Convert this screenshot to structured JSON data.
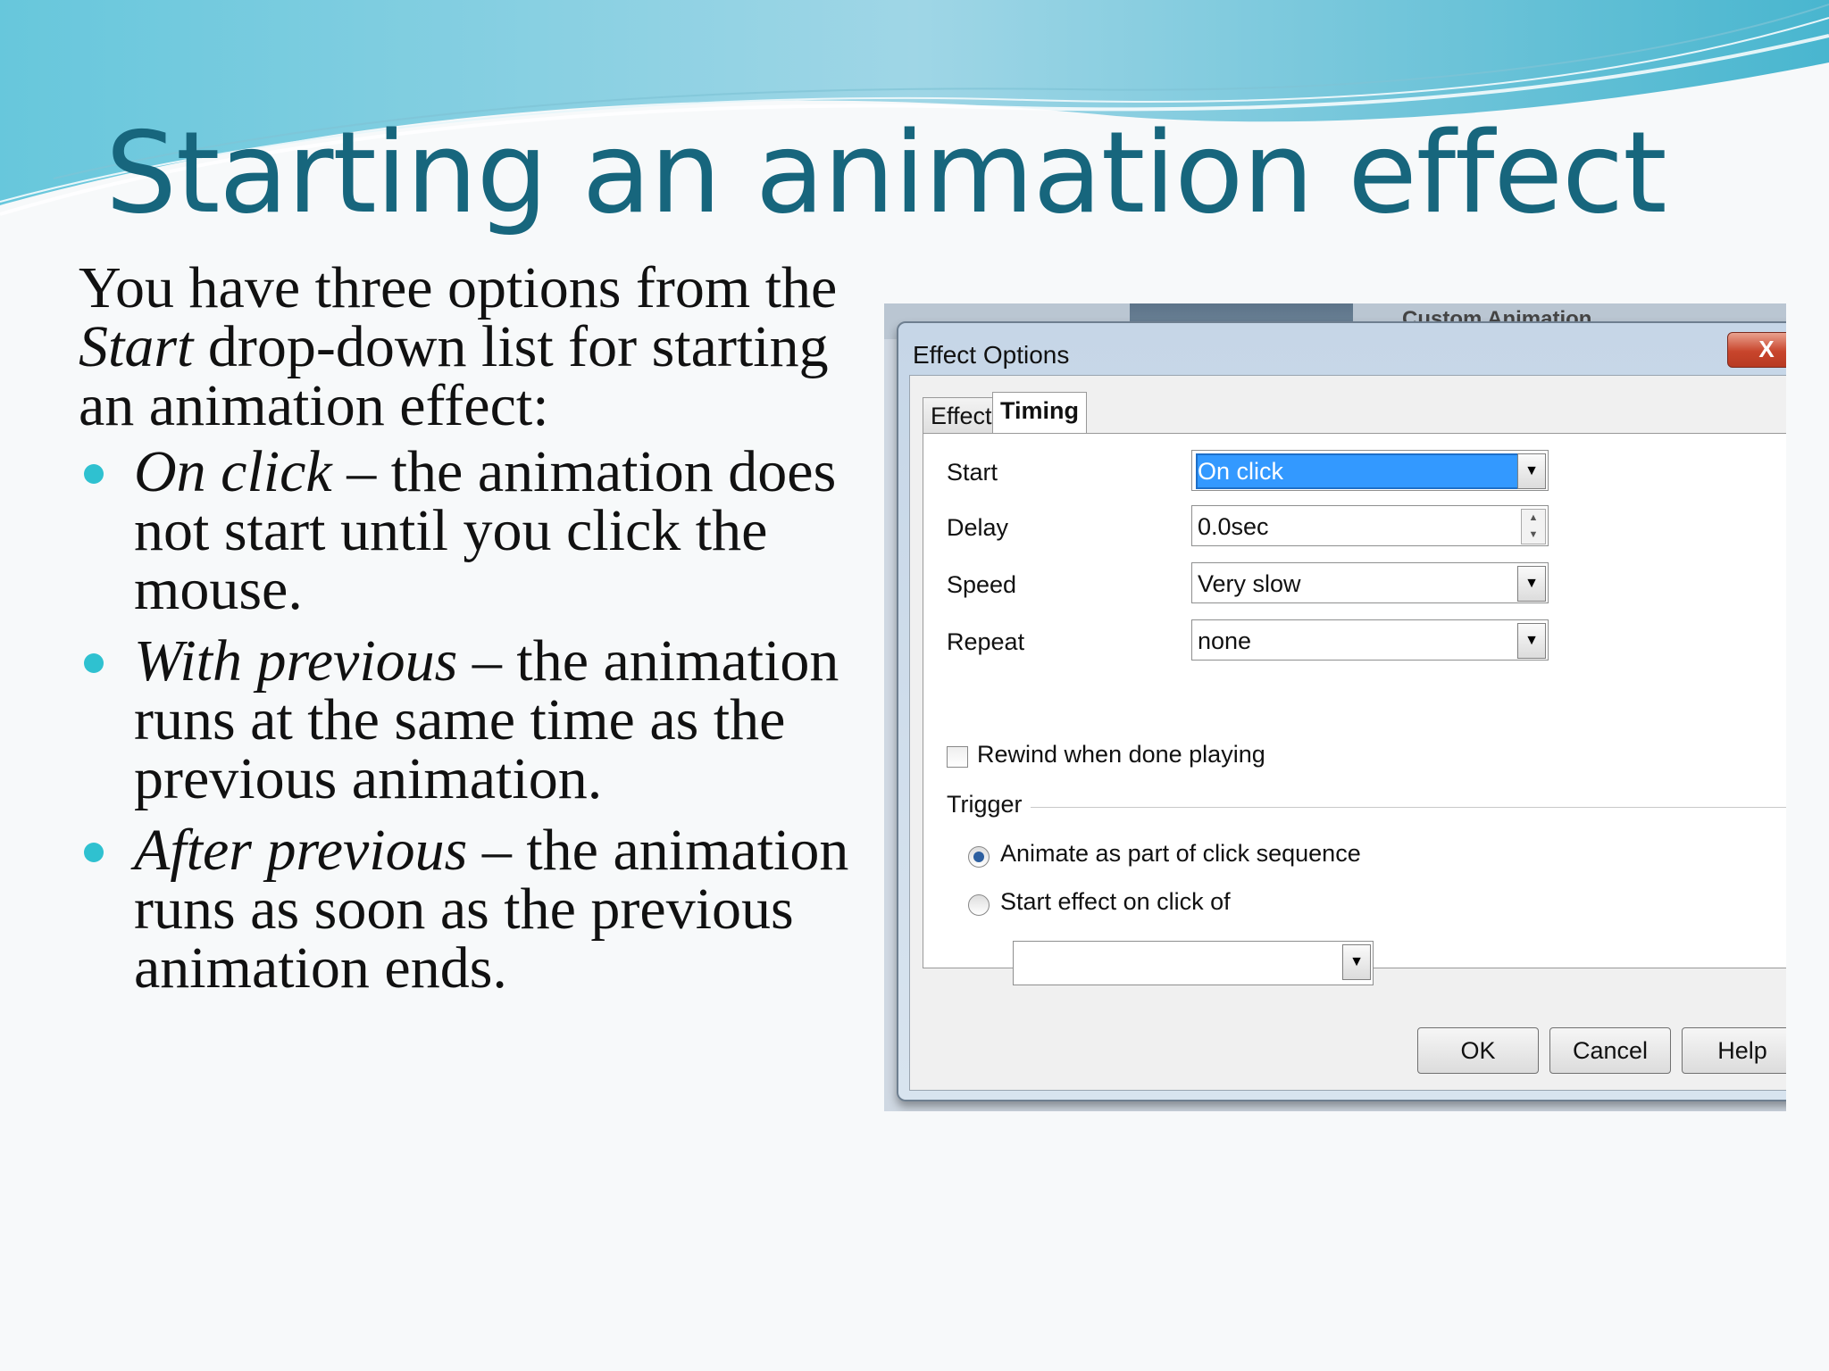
{
  "slide": {
    "title": "Starting an animation effect",
    "intro_before": "You have three options from the ",
    "intro_italic": "Start",
    "intro_after": " drop-down list for starting an animation effect:",
    "bullets": [
      {
        "term": "On click",
        "text": " – the animation does not start until you click the mouse."
      },
      {
        "term": "With previous",
        "text": " – the animation runs at the same time as the previous animation."
      },
      {
        "term": "After previous",
        "text": " – the animation runs as soon as the previous animation ends."
      }
    ],
    "colors": {
      "title": "#17667d",
      "bullet": "#2fc1d0"
    }
  },
  "screenshot": {
    "behind_window_title": "Custom Animation",
    "dialog": {
      "title": "Effect Options",
      "close_label": "X",
      "tabs": [
        {
          "label": "Effect",
          "active": false
        },
        {
          "label": "Timing",
          "active": true
        }
      ],
      "fields": {
        "start": {
          "label": "Start",
          "value": "On click"
        },
        "delay": {
          "label": "Delay",
          "value": "0.0sec"
        },
        "speed": {
          "label": "Speed",
          "value": "Very slow"
        },
        "repeat": {
          "label": "Repeat",
          "value": "none"
        }
      },
      "rewind_label": "Rewind when done playing",
      "rewind_checked": false,
      "trigger_label": "Trigger",
      "radio_animate_label": "Animate as part of click sequence",
      "radio_start_label": "Start effect on click of",
      "selected_radio": "Animate as part of click sequence",
      "click_of_value": "",
      "buttons": {
        "ok": "OK",
        "cancel": "Cancel",
        "help": "Help"
      }
    }
  }
}
